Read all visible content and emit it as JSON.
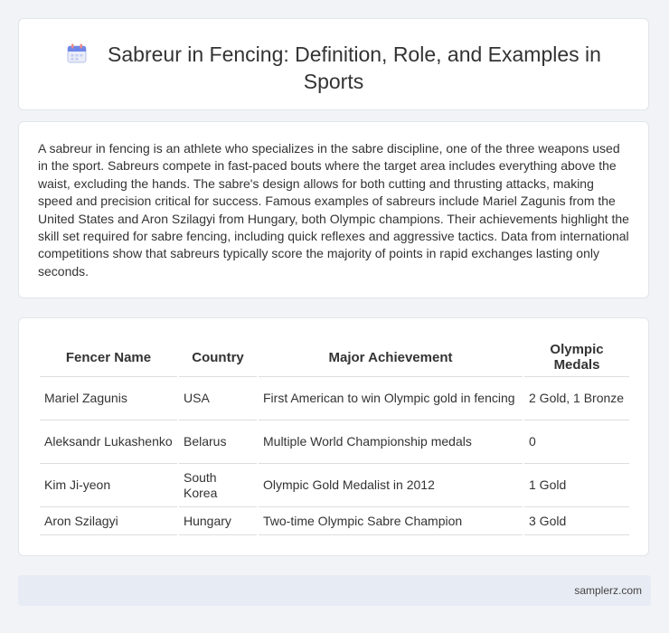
{
  "header": {
    "title": "Sabreur in Fencing: Definition, Role, and Examples in Sports",
    "icon": "calendar-icon"
  },
  "summary": {
    "text": "A sabreur in fencing is an athlete who specializes in the sabre discipline, one of the three weapons used in the sport. Sabreurs compete in fast-paced bouts where the target area includes everything above the waist, excluding the hands. The sabre's design allows for both cutting and thrusting attacks, making speed and precision critical for success. Famous examples of sabreurs include Mariel Zagunis from the United States and Aron Szilagyi from Hungary, both Olympic champions. Their achievements highlight the skill set required for sabre fencing, including quick reflexes and aggressive tactics. Data from international competitions show that sabreurs typically score the majority of points in rapid exchanges lasting only seconds."
  },
  "table": {
    "headers": [
      "Fencer Name",
      "Country",
      "Major Achievement",
      "Olympic Medals"
    ],
    "rows": [
      [
        "Mariel Zagunis",
        "USA",
        "First American to win Olympic gold in fencing",
        "2 Gold, 1 Bronze"
      ],
      [
        "Aleksandr Lukashenko",
        "Belarus",
        "Multiple World Championship medals",
        "0"
      ],
      [
        "Kim Ji-yeon",
        "South Korea",
        "Olympic Gold Medalist in 2012",
        "1 Gold"
      ],
      [
        "Aron Szilagyi",
        "Hungary",
        "Two-time Olympic Sabre Champion",
        "3 Gold"
      ]
    ]
  },
  "footer": {
    "site": "samplerz.com"
  }
}
